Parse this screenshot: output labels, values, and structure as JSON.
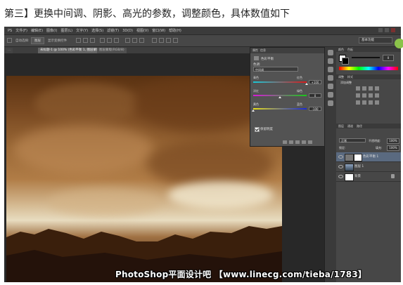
{
  "caption": "第三】更换中间调、阴影、高光的参数，调整颜色，具体数值如下",
  "menubar": {
    "items": [
      "PS",
      "文件(F)",
      "编辑(E)",
      "图像(I)",
      "图层(L)",
      "文字(Y)",
      "选择(S)",
      "滤镜(T)",
      "3D(D)",
      "视图(V)",
      "窗口(W)",
      "帮助(H)"
    ]
  },
  "options": {
    "auto_select": "自动选择:",
    "layer_dropdown": "图层",
    "show_transform": "显示变换控件",
    "workspace": "基本功能"
  },
  "tabs": [
    {
      "label": "未标题-1 @ 100% (色彩平衡 1, 图层蒙版/8)"
    },
    {
      "label": "图层蒙版(RGB/8)"
    }
  ],
  "properties": {
    "tabs": [
      "属性",
      "信息"
    ],
    "title": "色彩平衡",
    "tone_label": "色调:",
    "tone": "中间调",
    "sliders": [
      {
        "left": "青色",
        "right": "红色",
        "value": "+100",
        "level": 1.0,
        "colors": [
          "#18c8d8",
          "#d81818"
        ]
      },
      {
        "left": "洋红",
        "right": "绿色",
        "value": "0",
        "level": 0.5,
        "colors": [
          "#d818d8",
          "#18c818"
        ]
      },
      {
        "left": "黄色",
        "right": "蓝色",
        "value": "-100",
        "level": 0.0,
        "colors": [
          "#e8e018",
          "#1828d8"
        ]
      }
    ],
    "preserve_luminosity": "保留明度"
  },
  "right_panel": {
    "color_tabs": [
      "颜色",
      "色板"
    ],
    "color_value": "0",
    "adjust_tabs": [
      "调整",
      "样式"
    ],
    "adjust_title": "添加调整",
    "layers_tabs": [
      "图层",
      "通道",
      "路径"
    ],
    "blend_mode": "正常",
    "opacity_label": "不透明度:",
    "opacity": "100%",
    "lock_label": "锁定:",
    "fill_label": "填充:",
    "fill": "100%",
    "layers": [
      {
        "name": "色彩平衡 1"
      },
      {
        "name": "图层 1"
      },
      {
        "name": "背景"
      }
    ]
  },
  "watermark": "PhotoShop平面设计吧 【www.linecg.com/tieba/1783】"
}
